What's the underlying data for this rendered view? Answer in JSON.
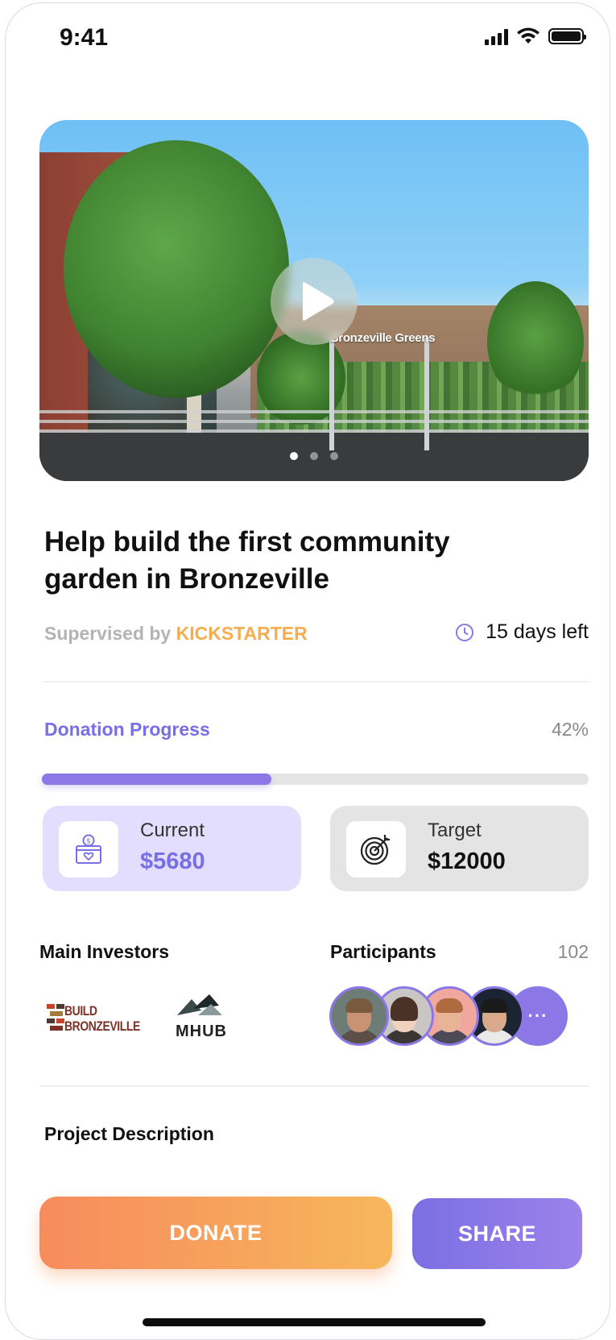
{
  "status_bar": {
    "time": "9:41"
  },
  "hero": {
    "sign_text": "Bronzeville Greens",
    "slide_count": 3,
    "active_slide": 1
  },
  "project": {
    "title": "Help build the first community garden in Bronzeville",
    "supervised_prefix": "Supervised by",
    "supervisor": "KICKSTARTER",
    "days_left": "15 days left"
  },
  "donation": {
    "label": "Donation Progress",
    "percent_text": "42%",
    "progress": 0.42,
    "current_label": "Current",
    "current_value": "$5680",
    "target_label": "Target",
    "target_value": "$12000"
  },
  "investors": {
    "title": "Main Investors",
    "logos": [
      {
        "name": "build-bronzeville-logo",
        "line1": "BUILD",
        "line2": "BRONZEVILLE"
      },
      {
        "name": "mhub-logo",
        "text": "MHUB"
      }
    ]
  },
  "participants": {
    "title": "Participants",
    "count": "102",
    "more_label": "···"
  },
  "description": {
    "title": "Project Description"
  },
  "actions": {
    "donate_label": "DONATE",
    "share_label": "SHARE"
  },
  "colors": {
    "accent": "#8b78e6",
    "brand_orange": "#f5ad4e",
    "donate_gradient": [
      "#f78b5d",
      "#f7b75c"
    ]
  }
}
